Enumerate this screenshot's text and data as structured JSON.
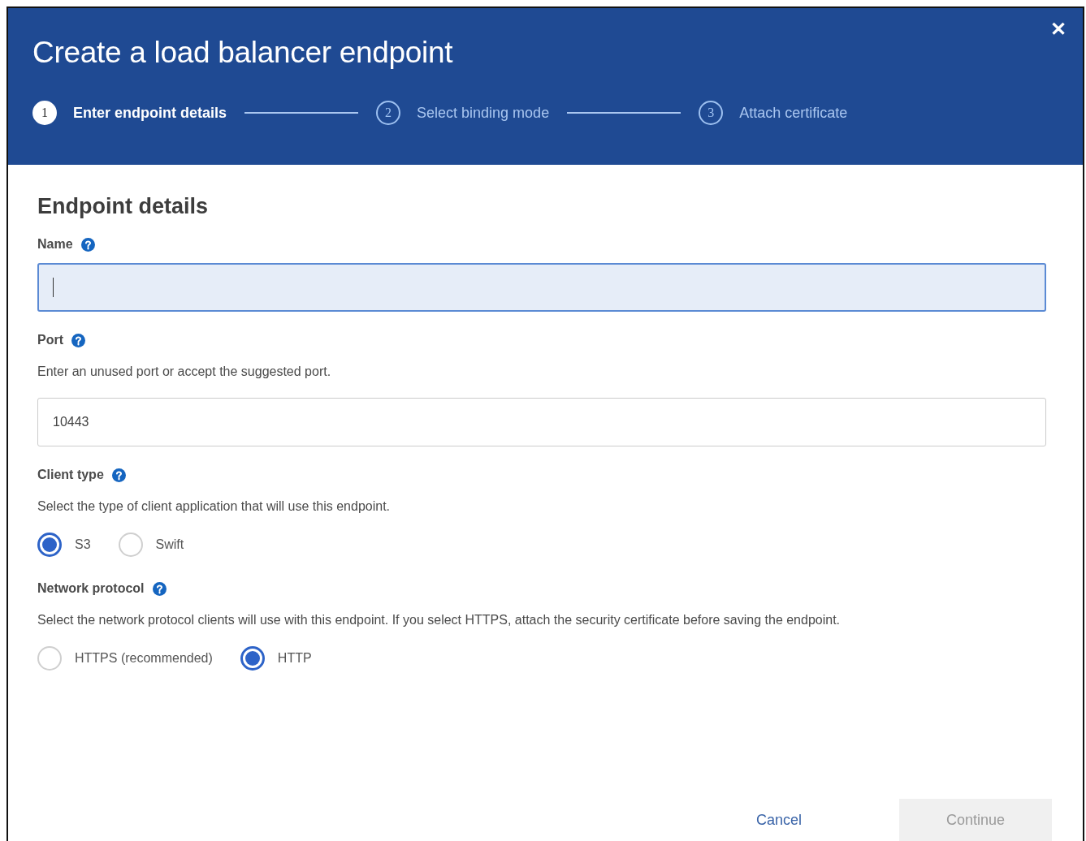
{
  "dialog": {
    "title": "Create a load balancer endpoint",
    "close": "✕"
  },
  "steps": [
    {
      "number": "1",
      "label": "Enter endpoint details",
      "selected": true
    },
    {
      "number": "2",
      "label": "Select binding mode",
      "selected": false
    },
    {
      "number": "3",
      "label": "Attach certificate",
      "selected": false
    }
  ],
  "section": {
    "heading": "Endpoint details"
  },
  "fields": [
    {
      "kind": "text",
      "label": "Name",
      "focused": true
    },
    {
      "kind": "text",
      "label": "Port",
      "help": "Enter an unused port or accept the suggested port.",
      "value": "10443",
      "focused": false
    },
    {
      "kind": "radio",
      "label": "Client type",
      "help": "Select the type of client application that will use this endpoint.",
      "options": [
        {
          "label": "S3",
          "selected": true
        },
        {
          "label": "Swift",
          "selected": false
        }
      ]
    },
    {
      "kind": "radio",
      "label": "Network protocol",
      "help": "Select the network protocol clients will use with this endpoint. If you select HTTPS, attach the security certificate before saving the endpoint.",
      "options": [
        {
          "label": "HTTPS (recommended)",
          "selected": false
        },
        {
          "label": "HTTP",
          "selected": true
        }
      ]
    }
  ],
  "buttons": [
    {
      "kind": "link",
      "label": "Cancel",
      "disabled": false
    },
    {
      "kind": "primary",
      "label": "Continue",
      "disabled": true
    }
  ]
}
